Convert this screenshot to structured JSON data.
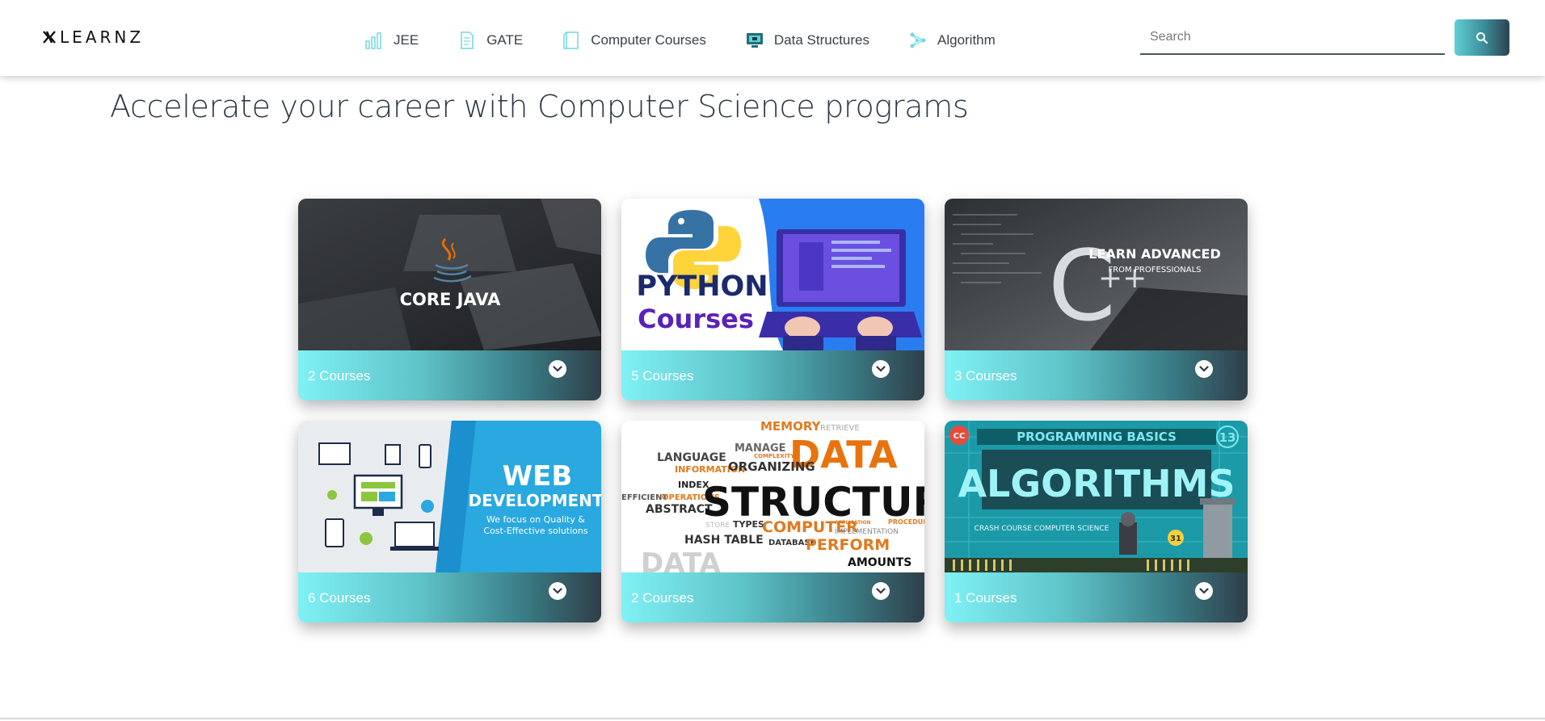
{
  "brand": {
    "name": "LEARNZ"
  },
  "nav": {
    "items": [
      {
        "label": "JEE",
        "icon": "bar-chart-icon"
      },
      {
        "label": "GATE",
        "icon": "document-icon"
      },
      {
        "label": "Computer Courses",
        "icon": "notebook-icon"
      },
      {
        "label": "Data Structures",
        "icon": "computer-chip-icon"
      },
      {
        "label": "Algorithm",
        "icon": "network-icon"
      }
    ]
  },
  "search": {
    "placeholder": "Search",
    "value": "",
    "button_icon": "search-icon"
  },
  "page": {
    "title": "Accelerate your career with Computer Science programs"
  },
  "colors": {
    "accent_start": "#7ff1f5",
    "accent_end": "#2f3f49",
    "title": "#2d3845"
  },
  "cards": [
    {
      "image_text": "CORE JAVA",
      "count": "2 Courses"
    },
    {
      "image_text_1": "PYTHON",
      "image_text_2": "Courses",
      "count": "5 Courses"
    },
    {
      "image_text_1": "LEARN ADVANCED",
      "image_text_2": "FROM PROFESSIONALS",
      "count": "3 Courses"
    },
    {
      "image_text_1": "WEB",
      "image_text_2": "DEVELOPMENT",
      "image_text_3": "We focus on Quality &",
      "image_text_4": "Cost-Effective solutions",
      "count": "6 Courses"
    },
    {
      "words": [
        "MEMORY",
        "RETRIEVE",
        "LANGUAGE",
        "MANAGE",
        "COMPLEXITY",
        "DATA",
        "INFORMATION",
        "ORGANIZING",
        "INDEX",
        "EFFICIENT",
        "OPERATIONS",
        "ABSTRACT",
        "STRUCTURE",
        "STORE",
        "TYPES",
        "COMPUTER",
        "APPLICATION",
        "IMPLEMENTATION",
        "PROCEDURES",
        "HASH TABLE",
        "DATABASE",
        "PERFORM",
        "AMOUNTS",
        "DATA"
      ],
      "count": "2 Courses"
    },
    {
      "image_text_1": "PROGRAMMING BASICS",
      "image_text_2": "ALGORITHMS",
      "image_text_3": "CRASH COURSE COMPUTER SCIENCE",
      "badge_num": "13",
      "badge_cc": "CC",
      "dot_num": "31",
      "count": "1 Courses"
    }
  ]
}
